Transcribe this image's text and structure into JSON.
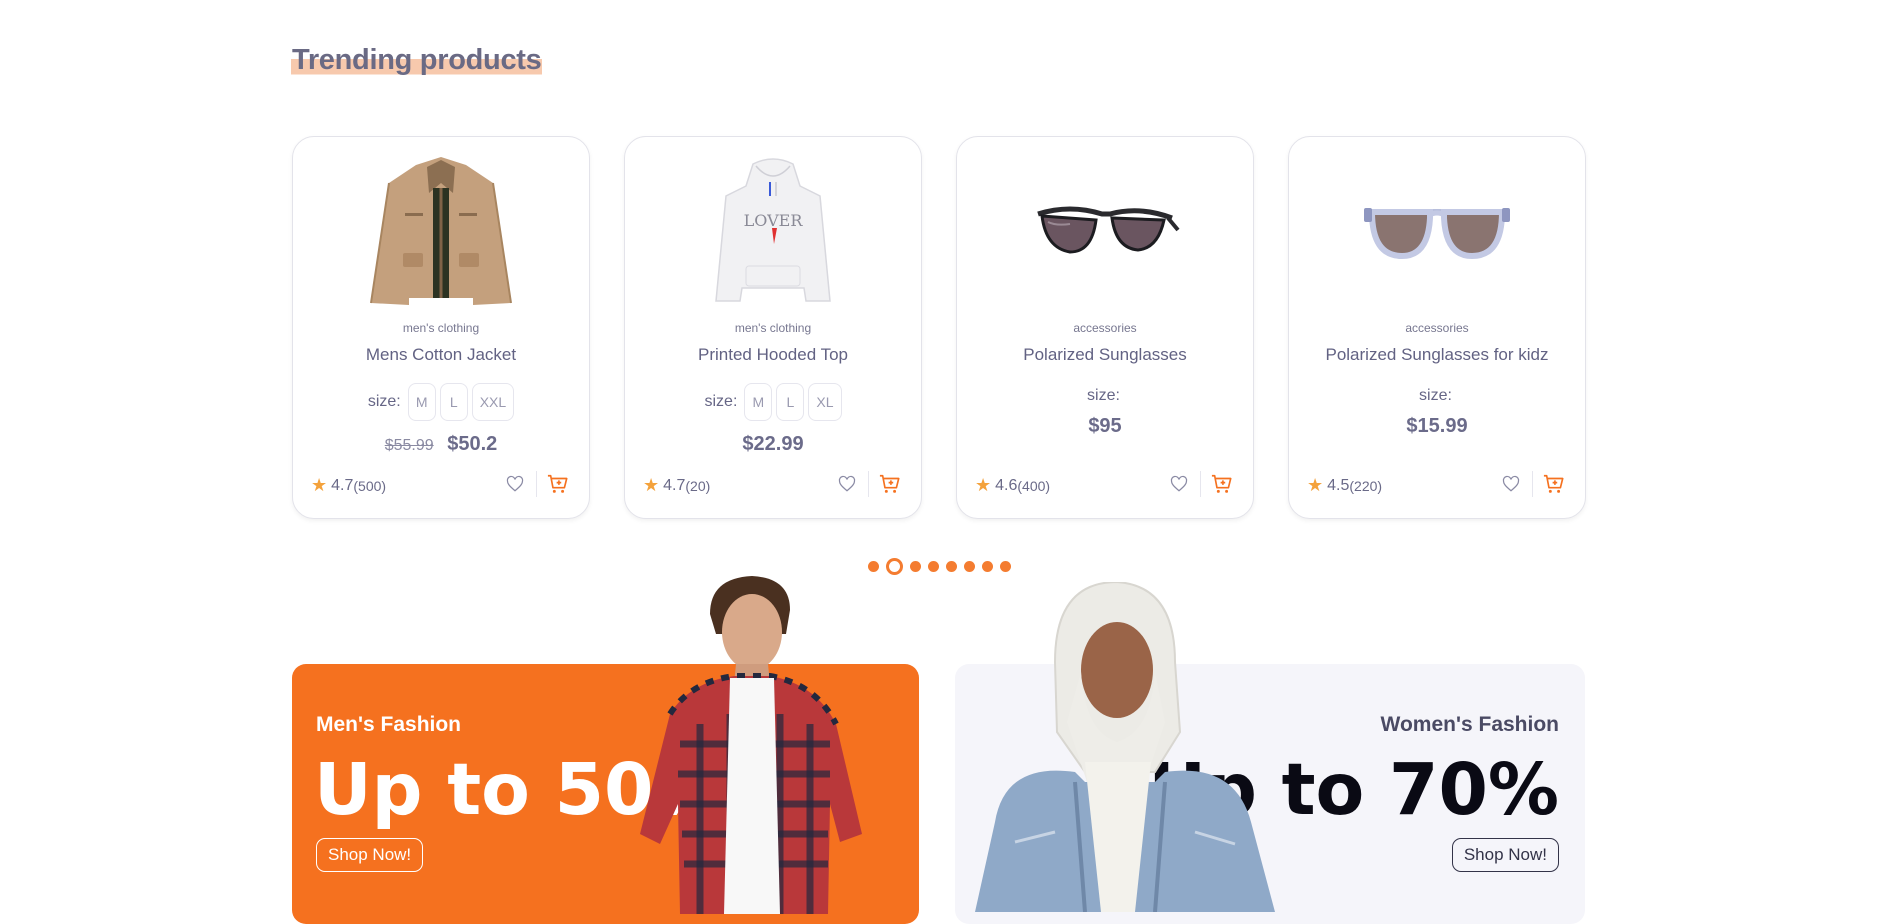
{
  "section": {
    "title": "Trending products"
  },
  "products": [
    {
      "category": "men's clothing",
      "name": "Mens Cotton Jacket",
      "size_label": "size:",
      "sizes": [
        "M",
        "L",
        "XXL"
      ],
      "old_price": "$55.99",
      "price": "$50.2",
      "rating": "4.7",
      "reviews": "(500)",
      "image": "jacket"
    },
    {
      "category": "men's clothing",
      "name": "Printed Hooded Top",
      "size_label": "size:",
      "sizes": [
        "M",
        "L",
        "XL"
      ],
      "old_price": "",
      "price": "$22.99",
      "rating": "4.7",
      "reviews": "(20)",
      "image": "hoodie",
      "hoodie_print": "LOVER"
    },
    {
      "category": "accessories",
      "name": "Polarized Sunglasses",
      "size_label": "size:",
      "sizes": [],
      "old_price": "",
      "price": "$95",
      "rating": "4.6",
      "reviews": "(400)",
      "image": "sunglasses-dark"
    },
    {
      "category": "accessories",
      "name": "Polarized Sunglasses for kidz",
      "size_label": "size:",
      "sizes": [],
      "old_price": "",
      "price": "$15.99",
      "rating": "4.5",
      "reviews": "(220)",
      "image": "sunglasses-clear"
    }
  ],
  "carousel": {
    "count": 8,
    "active": 1
  },
  "banners": {
    "men": {
      "label": "Men's Fashion",
      "headline": "Up to 50%",
      "button": "Shop Now!"
    },
    "women": {
      "label": "Women's Fashion",
      "headline": "Up to 70%",
      "button": "Shop Now!"
    }
  },
  "colors": {
    "accent": "#f5711f",
    "star": "#f4a23c",
    "text": "#6a6a88",
    "women_bg": "#f5f5fa"
  }
}
